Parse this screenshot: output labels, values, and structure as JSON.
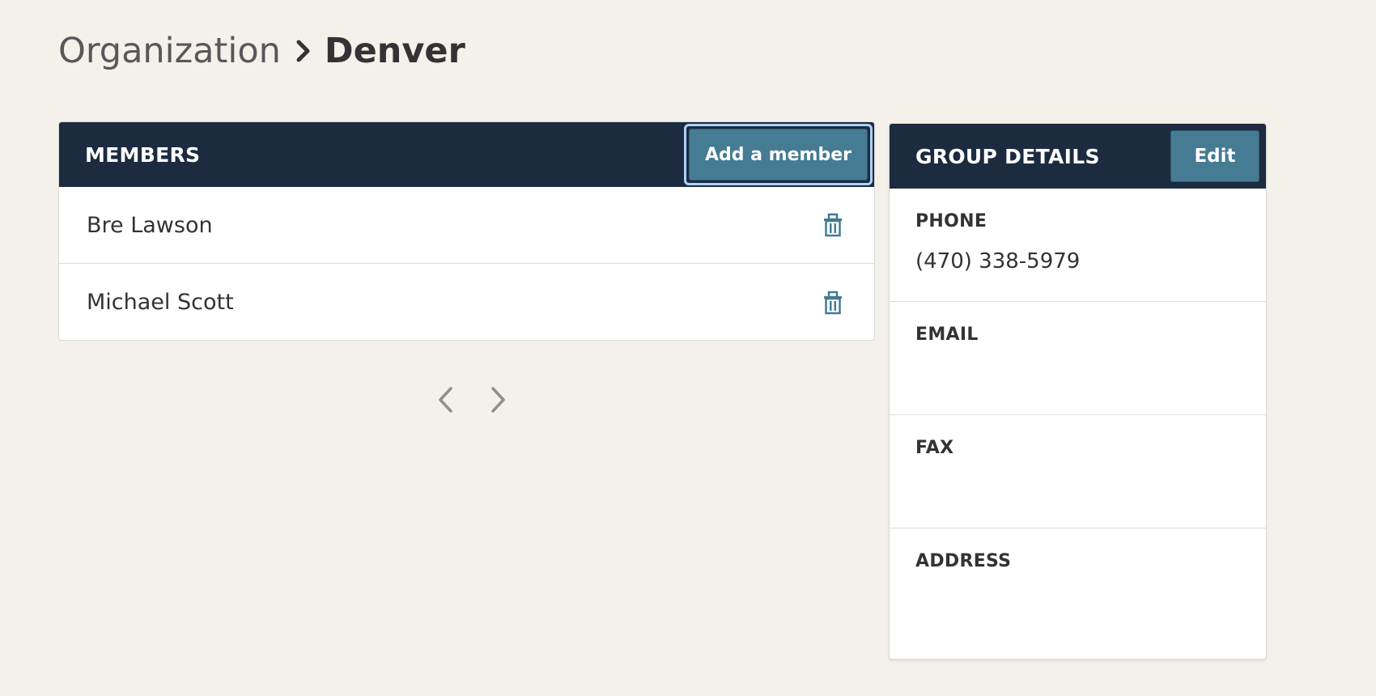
{
  "breadcrumb": {
    "parent": "Organization",
    "current": "Denver",
    "separator_icon": "chevron-right-icon"
  },
  "members": {
    "title": "MEMBERS",
    "add_button_label": "Add a member",
    "rows": [
      {
        "name": "Bre Lawson",
        "action_icon": "trash-icon"
      },
      {
        "name": "Michael Scott",
        "action_icon": "trash-icon"
      }
    ]
  },
  "pagination": {
    "prev_icon": "chevron-left-icon",
    "next_icon": "chevron-right-icon"
  },
  "group_details": {
    "title": "GROUP DETAILS",
    "edit_label": "Edit",
    "phone_label": "PHONE",
    "phone_value": "(470) 338-5979",
    "email_label": "EMAIL",
    "email_value": "",
    "fax_label": "FAX",
    "fax_value": "",
    "address_label": "ADDRESS",
    "address_value": ""
  },
  "colors": {
    "background": "#f4f1ea",
    "header": "#1c2b40",
    "button": "#457b93",
    "focus_ring": "#a9d2f5",
    "icon_accent": "#457b93"
  }
}
